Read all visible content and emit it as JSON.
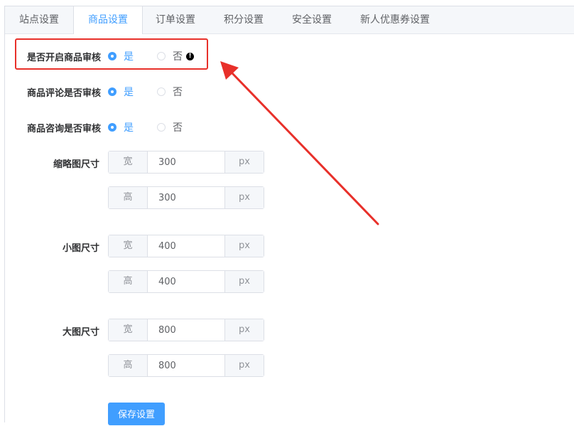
{
  "tabs": [
    {
      "label": "站点设置"
    },
    {
      "label": "商品设置"
    },
    {
      "label": "订单设置"
    },
    {
      "label": "积分设置"
    },
    {
      "label": "安全设置"
    },
    {
      "label": "新人优惠券设置"
    }
  ],
  "active_tab": "商品设置",
  "form": {
    "goods_audit": {
      "label": "是否开启商品审核",
      "yes": "是",
      "no": "否",
      "selected": "是"
    },
    "comment_audit": {
      "label": "商品评论是否审核",
      "yes": "是",
      "no": "否",
      "selected": "是"
    },
    "consult_audit": {
      "label": "商品咨询是否审核",
      "yes": "是",
      "no": "否",
      "selected": "是"
    },
    "thumb": {
      "label": "缩略图尺寸",
      "width_prefix": "宽",
      "width": "300",
      "height_prefix": "高",
      "height": "300",
      "unit": "px"
    },
    "small": {
      "label": "小图尺寸",
      "width_prefix": "宽",
      "width": "400",
      "height_prefix": "高",
      "height": "400",
      "unit": "px"
    },
    "large": {
      "label": "大图尺寸",
      "width_prefix": "宽",
      "width": "800",
      "height_prefix": "高",
      "height": "800",
      "unit": "px"
    },
    "save_label": "保存设置"
  },
  "colors": {
    "accent": "#409eff",
    "annotation": "#e8302a"
  },
  "icons": {
    "warning": "exclamation-circle-icon"
  }
}
